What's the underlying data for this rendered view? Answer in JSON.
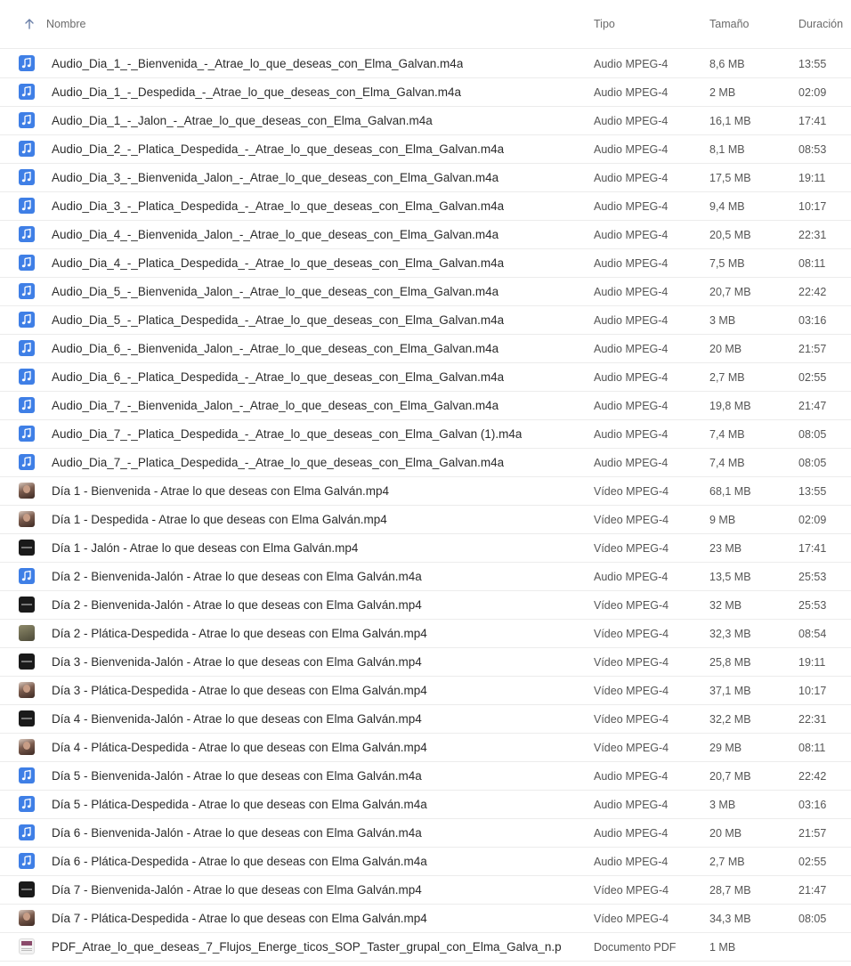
{
  "header": {
    "sort_icon": "arrow-up-icon",
    "name_label": "Nombre",
    "type_label": "Tipo",
    "size_label": "Tamaño",
    "duration_label": "Duración"
  },
  "files": [
    {
      "icon": "audio",
      "name": "Audio_Dia_1_-_Bienvenida_-_Atrae_lo_que_deseas_con_Elma_Galvan.m4a",
      "type": "Audio MPEG-4",
      "size": "8,6 MB",
      "duration": "13:55"
    },
    {
      "icon": "audio",
      "name": "Audio_Dia_1_-_Despedida_-_Atrae_lo_que_deseas_con_Elma_Galvan.m4a",
      "type": "Audio MPEG-4",
      "size": "2 MB",
      "duration": "02:09"
    },
    {
      "icon": "audio",
      "name": "Audio_Dia_1_-_Jalon_-_Atrae_lo_que_deseas_con_Elma_Galvan.m4a",
      "type": "Audio MPEG-4",
      "size": "16,1 MB",
      "duration": "17:41"
    },
    {
      "icon": "audio",
      "name": "Audio_Dia_2_-_Platica_Despedida_-_Atrae_lo_que_deseas_con_Elma_Galvan.m4a",
      "type": "Audio MPEG-4",
      "size": "8,1 MB",
      "duration": "08:53"
    },
    {
      "icon": "audio",
      "name": "Audio_Dia_3_-_Bienvenida_Jalon_-_Atrae_lo_que_deseas_con_Elma_Galvan.m4a",
      "type": "Audio MPEG-4",
      "size": "17,5 MB",
      "duration": "19:11"
    },
    {
      "icon": "audio",
      "name": "Audio_Dia_3_-_Platica_Despedida_-_Atrae_lo_que_deseas_con_Elma_Galvan.m4a",
      "type": "Audio MPEG-4",
      "size": "9,4 MB",
      "duration": "10:17"
    },
    {
      "icon": "audio",
      "name": "Audio_Dia_4_-_Bienvenida_Jalon_-_Atrae_lo_que_deseas_con_Elma_Galvan.m4a",
      "type": "Audio MPEG-4",
      "size": "20,5 MB",
      "duration": "22:31"
    },
    {
      "icon": "audio",
      "name": "Audio_Dia_4_-_Platica_Despedida_-_Atrae_lo_que_deseas_con_Elma_Galvan.m4a",
      "type": "Audio MPEG-4",
      "size": "7,5 MB",
      "duration": "08:11"
    },
    {
      "icon": "audio",
      "name": "Audio_Dia_5_-_Bienvenida_Jalon_-_Atrae_lo_que_deseas_con_Elma_Galvan.m4a",
      "type": "Audio MPEG-4",
      "size": "20,7 MB",
      "duration": "22:42"
    },
    {
      "icon": "audio",
      "name": "Audio_Dia_5_-_Platica_Despedida_-_Atrae_lo_que_deseas_con_Elma_Galvan.m4a",
      "type": "Audio MPEG-4",
      "size": "3 MB",
      "duration": "03:16"
    },
    {
      "icon": "audio",
      "name": "Audio_Dia_6_-_Bienvenida_Jalon_-_Atrae_lo_que_deseas_con_Elma_Galvan.m4a",
      "type": "Audio MPEG-4",
      "size": "20 MB",
      "duration": "21:57"
    },
    {
      "icon": "audio",
      "name": "Audio_Dia_6_-_Platica_Despedida_-_Atrae_lo_que_deseas_con_Elma_Galvan.m4a",
      "type": "Audio MPEG-4",
      "size": "2,7 MB",
      "duration": "02:55"
    },
    {
      "icon": "audio",
      "name": "Audio_Dia_7_-_Bienvenida_Jalon_-_Atrae_lo_que_deseas_con_Elma_Galvan.m4a",
      "type": "Audio MPEG-4",
      "size": "19,8 MB",
      "duration": "21:47"
    },
    {
      "icon": "audio",
      "name": "Audio_Dia_7_-_Platica_Despedida_-_Atrae_lo_que_deseas_con_Elma_Galvan (1).m4a",
      "type": "Audio MPEG-4",
      "size": "7,4 MB",
      "duration": "08:05"
    },
    {
      "icon": "audio",
      "name": "Audio_Dia_7_-_Platica_Despedida_-_Atrae_lo_que_deseas_con_Elma_Galvan.m4a",
      "type": "Audio MPEG-4",
      "size": "7,4 MB",
      "duration": "08:05"
    },
    {
      "icon": "video-photo",
      "name": "Día 1 - Bienvenida - Atrae lo que deseas con Elma Galván.mp4",
      "type": "Vídeo MPEG-4",
      "size": "68,1 MB",
      "duration": "13:55"
    },
    {
      "icon": "video-photo",
      "name": "Día 1 - Despedida - Atrae lo que deseas con Elma Galván.mp4",
      "type": "Vídeo MPEG-4",
      "size": "9 MB",
      "duration": "02:09"
    },
    {
      "icon": "video-dark",
      "name": "Día 1 - Jalón - Atrae lo que deseas con Elma Galván.mp4",
      "type": "Vídeo MPEG-4",
      "size": "23 MB",
      "duration": "17:41"
    },
    {
      "icon": "audio",
      "name": "Día 2 - Bienvenida-Jalón - Atrae lo que deseas con Elma Galván.m4a",
      "type": "Audio MPEG-4",
      "size": "13,5 MB",
      "duration": "25:53"
    },
    {
      "icon": "video-dark",
      "name": "Día 2 - Bienvenida-Jalón - Atrae lo que deseas con Elma Galván.mp4",
      "type": "Vídeo MPEG-4",
      "size": "32 MB",
      "duration": "25:53"
    },
    {
      "icon": "video-olive",
      "name": "Día 2 - Plática-Despedida - Atrae lo que deseas con Elma Galván.mp4",
      "type": "Vídeo MPEG-4",
      "size": "32,3 MB",
      "duration": "08:54"
    },
    {
      "icon": "video-dark",
      "name": "Día 3 - Bienvenida-Jalón - Atrae lo que deseas con Elma Galván.mp4",
      "type": "Vídeo MPEG-4",
      "size": "25,8 MB",
      "duration": "19:11"
    },
    {
      "icon": "video-photo",
      "name": "Día 3 - Plática-Despedida - Atrae lo que deseas con Elma Galván.mp4",
      "type": "Vídeo MPEG-4",
      "size": "37,1 MB",
      "duration": "10:17"
    },
    {
      "icon": "video-dark",
      "name": "Día 4 - Bienvenida-Jalón - Atrae lo que deseas con Elma Galván.mp4",
      "type": "Vídeo MPEG-4",
      "size": "32,2 MB",
      "duration": "22:31"
    },
    {
      "icon": "video-photo",
      "name": "Día 4 - Plática-Despedida - Atrae lo que deseas con Elma Galván.mp4",
      "type": "Vídeo MPEG-4",
      "size": "29 MB",
      "duration": "08:11"
    },
    {
      "icon": "audio",
      "name": "Día 5 - Bienvenida-Jalón - Atrae lo que deseas con Elma Galván.m4a",
      "type": "Audio MPEG-4",
      "size": "20,7 MB",
      "duration": "22:42"
    },
    {
      "icon": "audio",
      "name": "Día 5 - Plática-Despedida - Atrae lo que deseas con Elma Galván.m4a",
      "type": "Audio MPEG-4",
      "size": "3 MB",
      "duration": "03:16"
    },
    {
      "icon": "audio",
      "name": "Día 6 - Bienvenida-Jalón - Atrae lo que deseas con Elma Galván.m4a",
      "type": "Audio MPEG-4",
      "size": "20 MB",
      "duration": "21:57"
    },
    {
      "icon": "audio",
      "name": "Día 6 - Plática-Despedida - Atrae lo que deseas con Elma Galván.m4a",
      "type": "Audio MPEG-4",
      "size": "2,7 MB",
      "duration": "02:55"
    },
    {
      "icon": "video-dark",
      "name": "Día 7 - Bienvenida-Jalón - Atrae lo que deseas con Elma Galván.mp4",
      "type": "Vídeo MPEG-4",
      "size": "28,7 MB",
      "duration": "21:47"
    },
    {
      "icon": "video-photo",
      "name": "Día 7 - Plática-Despedida - Atrae lo que deseas con Elma Galván.mp4",
      "type": "Vídeo MPEG-4",
      "size": "34,3 MB",
      "duration": "08:05"
    },
    {
      "icon": "pdf",
      "name": "PDF_Atrae_lo_que_deseas_7_Flujos_Energe_ticos_SOP_Taster_grupal_con_Elma_Galva_n.p",
      "type": "Documento PDF",
      "size": "1 MB",
      "duration": ""
    }
  ],
  "colors": {
    "audio_icon": "#3f7fe6",
    "divider": "#ececec",
    "text": "#2b2b2b",
    "muted": "#6b6b6b"
  }
}
